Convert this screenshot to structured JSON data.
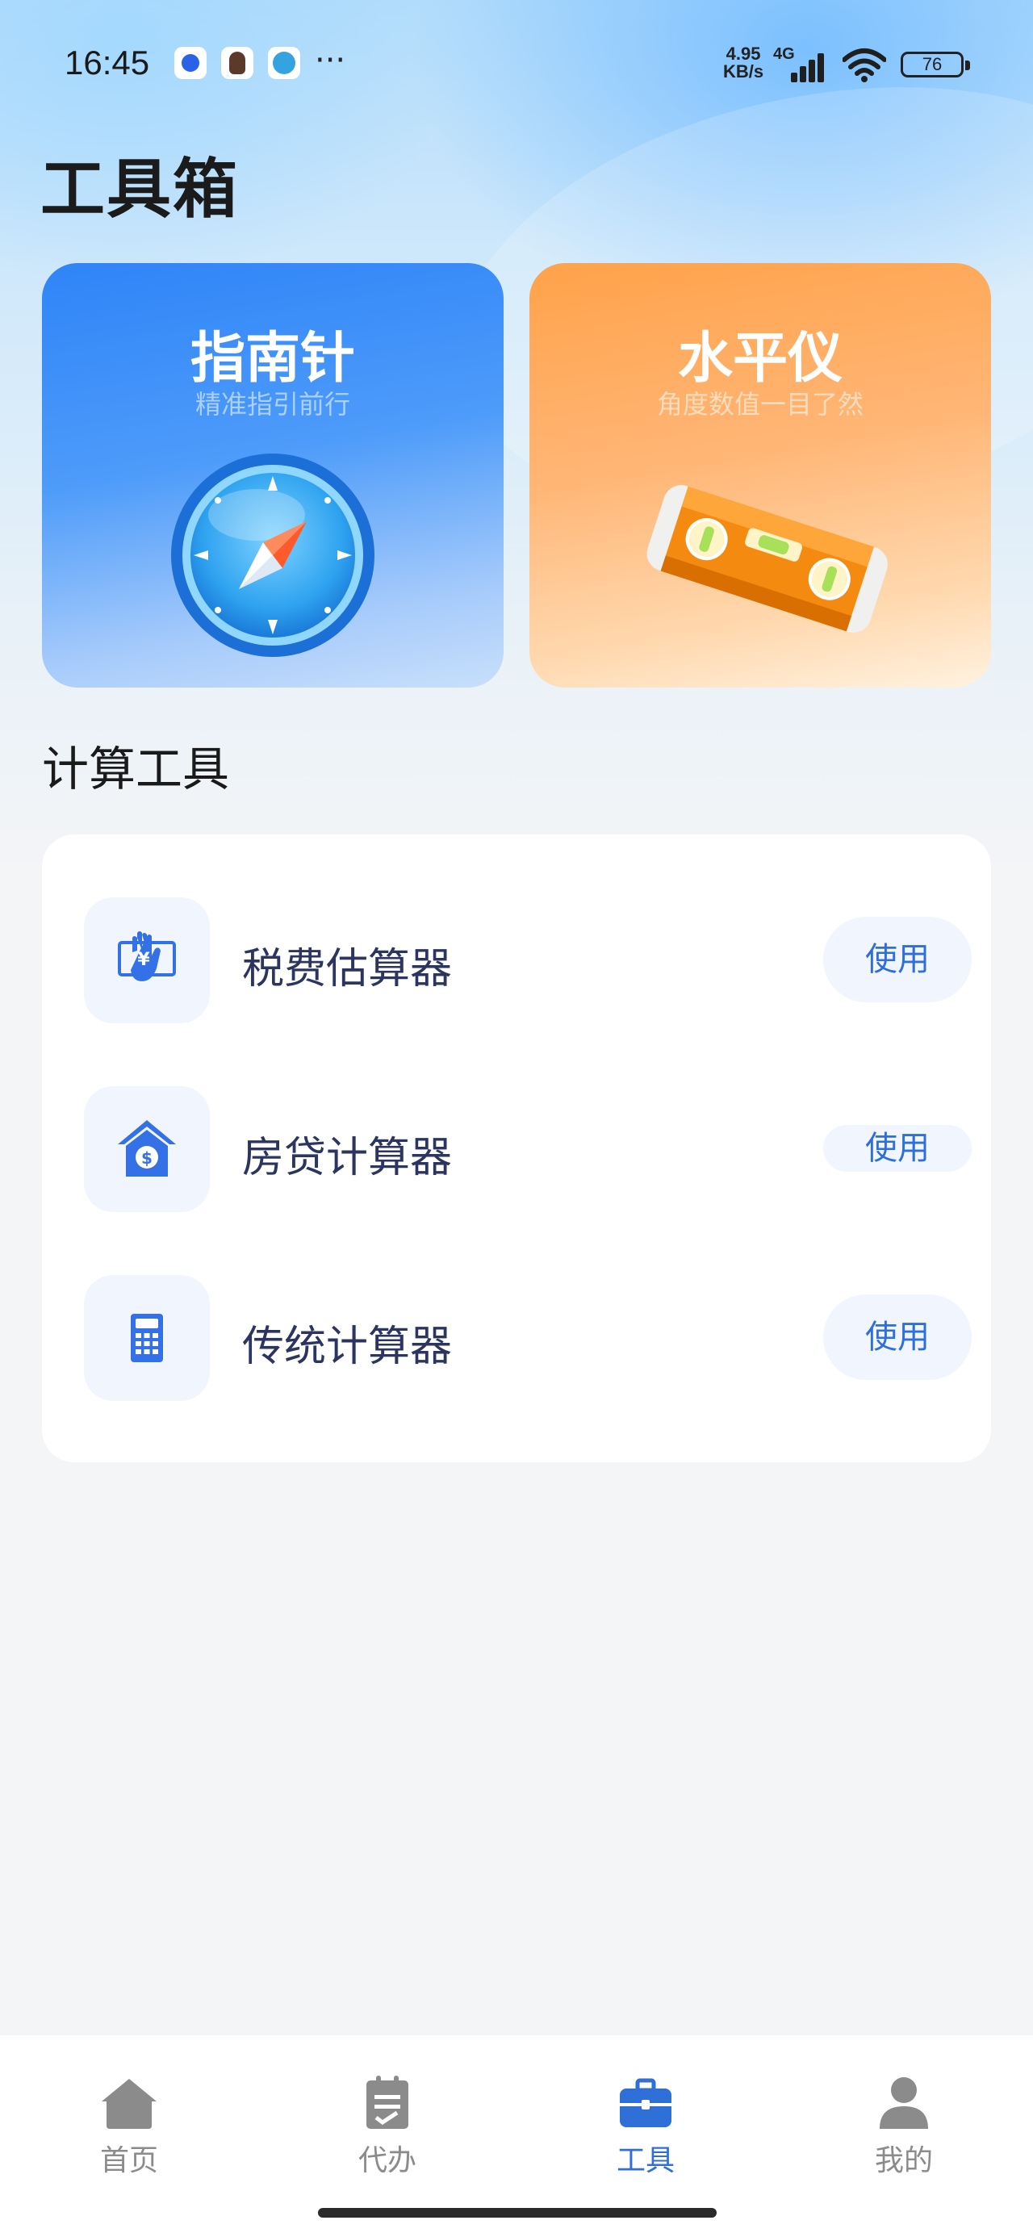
{
  "status_bar": {
    "time": "16:45",
    "net_speed_value": "4.95",
    "net_speed_unit": "KB/s",
    "network": "4G",
    "battery": "76"
  },
  "page": {
    "title": "工具箱"
  },
  "feature_cards": [
    {
      "title": "指南针",
      "subtitle": "精准指引前行",
      "icon": "compass-icon",
      "color": "#2f84f7"
    },
    {
      "title": "水平仪",
      "subtitle": "角度数值一目了然",
      "icon": "spirit-level-icon",
      "color": "#ffa24a"
    }
  ],
  "section": {
    "title": "计算工具"
  },
  "tools": [
    {
      "label": "税费估算器",
      "button": "使用",
      "icon": "tax-calculator-icon"
    },
    {
      "label": "房贷计算器",
      "button": "使用",
      "icon": "mortgage-house-icon"
    },
    {
      "label": "传统计算器",
      "button": "使用",
      "icon": "calculator-icon"
    }
  ],
  "tabbar": {
    "items": [
      {
        "label": "首页",
        "icon": "home-icon",
        "active": false
      },
      {
        "label": "代办",
        "icon": "clipboard-icon",
        "active": false
      },
      {
        "label": "工具",
        "icon": "toolbox-icon",
        "active": true
      },
      {
        "label": "我的",
        "icon": "user-icon",
        "active": false
      }
    ]
  },
  "colors": {
    "accent": "#2f6fd8",
    "tool_text": "#2c3560",
    "inactive_tab": "#8b8b8b"
  }
}
